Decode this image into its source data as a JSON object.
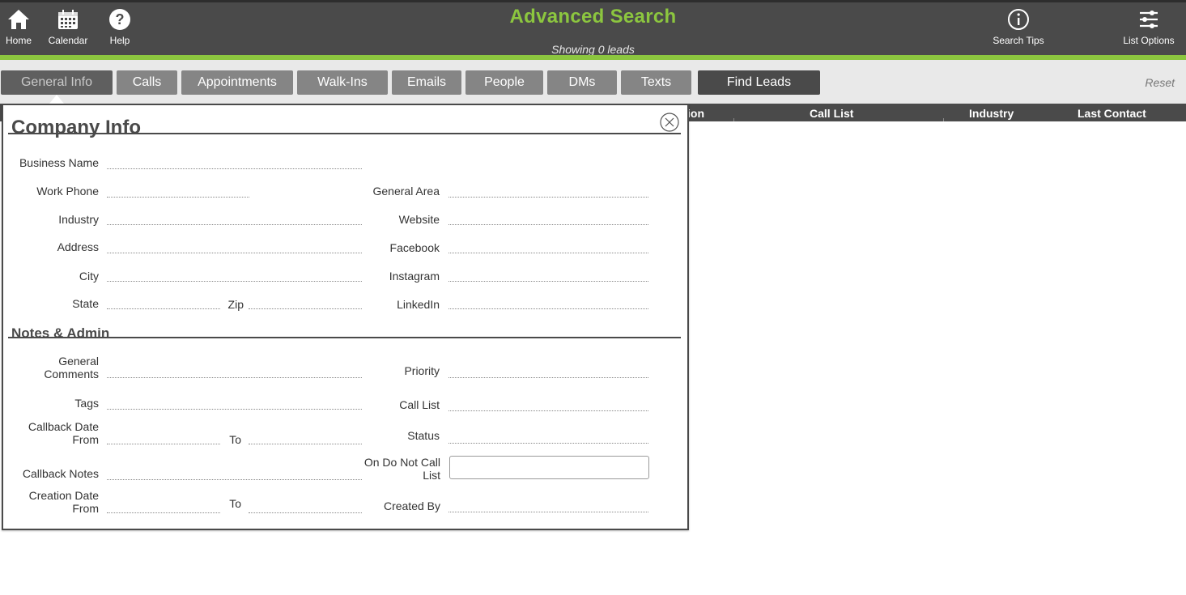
{
  "app": {
    "title": "Advanced Search",
    "lead_count": "Showing 0 leads",
    "accent_color": "#8cc63f"
  },
  "nav_left": [
    {
      "label": "Home",
      "icon": "home-icon"
    },
    {
      "label": "Calendar",
      "icon": "calendar-icon"
    },
    {
      "label": "Help",
      "icon": "help-icon"
    }
  ],
  "nav_right": [
    {
      "label": "Search Tips",
      "icon": "info-icon"
    },
    {
      "label": "List Options",
      "icon": "sliders-icon"
    }
  ],
  "tabs": [
    {
      "label": "General Info",
      "active": true
    },
    {
      "label": "Calls"
    },
    {
      "label": "Appointments"
    },
    {
      "label": "Walk-Ins"
    },
    {
      "label": "Emails"
    },
    {
      "label": "People"
    },
    {
      "label": "DMs"
    },
    {
      "label": "Texts"
    }
  ],
  "find_button": "Find Leads",
  "reset_label": "Reset",
  "columns": [
    "ion",
    "Call List",
    "Industry",
    "Last Contact"
  ],
  "panel": {
    "company_title": "Company Info",
    "notes_title": "Notes & Admin",
    "fields": {
      "business_name": "Business Name",
      "work_phone": "Work Phone",
      "general_area": "General Area",
      "industry": "Industry",
      "website": "Website",
      "address": "Address",
      "facebook": "Facebook",
      "city": "City",
      "instagram": "Instagram",
      "state": "State",
      "zip": "Zip",
      "linkedin": "LinkedIn",
      "general_comments_1": "General",
      "general_comments_2": "Comments",
      "priority": "Priority",
      "tags": "Tags",
      "call_list": "Call List",
      "callback_date_1": "Callback Date",
      "callback_date_2": "From",
      "callback_to": "To",
      "status": "Status",
      "callback_notes": "Callback Notes",
      "dnc_1": "On Do Not Call",
      "dnc_2": "List",
      "creation_date_1": "Creation Date",
      "creation_date_2": "From",
      "creation_to": "To",
      "created_by": "Created By"
    }
  }
}
